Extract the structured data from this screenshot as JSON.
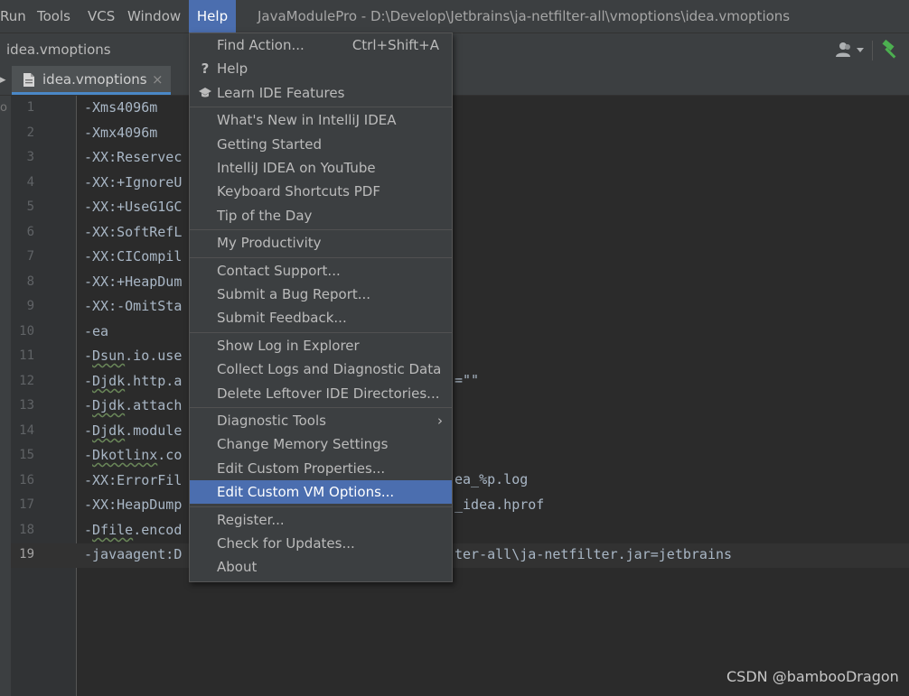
{
  "menubar": {
    "items": [
      "Run",
      "Tools",
      "VCS",
      "Window",
      "Help"
    ],
    "active": "Help",
    "window_title": "JavaModulePro - D:\\Develop\\Jetbrains\\ja-netfilter-all\\vmoptions\\idea.vmoptions"
  },
  "navbar": {
    "breadcrumb": "idea.vmoptions"
  },
  "tabs": [
    {
      "label": "idea.vmoptions",
      "close": "×"
    }
  ],
  "editor": {
    "current_line": "19",
    "lines": [
      {
        "no": "1",
        "pre": "-Xms4096m",
        "sq": "",
        "post": ""
      },
      {
        "no": "2",
        "pre": "-Xmx4096m",
        "sq": "",
        "post": ""
      },
      {
        "no": "3",
        "pre": "-XX:Reservec",
        "sq": "",
        "post": ""
      },
      {
        "no": "4",
        "pre": "-XX:+IgnoreU",
        "sq": "",
        "post": ""
      },
      {
        "no": "5",
        "pre": "-XX:+UseG1GC",
        "sq": "",
        "post": ""
      },
      {
        "no": "6",
        "pre": "-XX:SoftRefL",
        "sq": "",
        "post": ""
      },
      {
        "no": "7",
        "pre": "-XX:CICompil",
        "sq": "",
        "post": ""
      },
      {
        "no": "8",
        "pre": "-XX:+HeapDum",
        "sq": "",
        "post": ""
      },
      {
        "no": "9",
        "pre": "-XX:-OmitSta",
        "sq": "",
        "post": ""
      },
      {
        "no": "10",
        "pre": "-ea",
        "sq": "",
        "post": ""
      },
      {
        "no": "11",
        "pre": "-",
        "sq": "Dsun",
        "post": ".io.use"
      },
      {
        "no": "12",
        "pre": "-",
        "sq": "Djdk",
        "post": ".http.a"
      },
      {
        "no": "13",
        "pre": "-",
        "sq": "Djdk",
        "post": ".attach"
      },
      {
        "no": "14",
        "pre": "-",
        "sq": "Djdk",
        "post": ".module"
      },
      {
        "no": "15",
        "pre": "-",
        "sq": "Dkotlinx",
        "post": ".co"
      },
      {
        "no": "16",
        "pre": "-XX:ErrorFil",
        "sq": "",
        "post": ""
      },
      {
        "no": "17",
        "pre": "-XX:HeapDump",
        "sq": "",
        "post": ""
      },
      {
        "no": "18",
        "pre": "-",
        "sq": "Dfile",
        "post": ".encod"
      },
      {
        "no": "19",
        "pre": "-javaagent:D",
        "sq": "",
        "post": ""
      }
    ],
    "right_fragments": {
      "line12": "=\"\"",
      "line16": "ea_%p.log",
      "line17": "_idea.hprof",
      "line19": "ter-all\\ja-netfilter.jar=jetbrains"
    }
  },
  "help_menu": {
    "groups": [
      [
        {
          "label": "Find Action...",
          "shortcut": "Ctrl+Shift+A",
          "icon": ""
        },
        {
          "label": "Help",
          "shortcut": "",
          "icon": "?"
        },
        {
          "label": "Learn IDE Features",
          "shortcut": "",
          "icon": "graduation-cap"
        }
      ],
      [
        {
          "label": "What's New in IntelliJ IDEA",
          "shortcut": "",
          "icon": ""
        },
        {
          "label": "Getting Started",
          "shortcut": "",
          "icon": ""
        },
        {
          "label": "IntelliJ IDEA on YouTube",
          "shortcut": "",
          "icon": ""
        },
        {
          "label": "Keyboard Shortcuts PDF",
          "shortcut": "",
          "icon": ""
        },
        {
          "label": "Tip of the Day",
          "shortcut": "",
          "icon": ""
        }
      ],
      [
        {
          "label": "My Productivity",
          "shortcut": "",
          "icon": ""
        }
      ],
      [
        {
          "label": "Contact Support...",
          "shortcut": "",
          "icon": ""
        },
        {
          "label": "Submit a Bug Report...",
          "shortcut": "",
          "icon": ""
        },
        {
          "label": "Submit Feedback...",
          "shortcut": "",
          "icon": ""
        }
      ],
      [
        {
          "label": "Show Log in Explorer",
          "shortcut": "",
          "icon": ""
        },
        {
          "label": "Collect Logs and Diagnostic Data",
          "shortcut": "",
          "icon": ""
        },
        {
          "label": "Delete Leftover IDE Directories...",
          "shortcut": "",
          "icon": ""
        }
      ],
      [
        {
          "label": "Diagnostic Tools",
          "shortcut": "",
          "icon": "",
          "submenu": true
        },
        {
          "label": "Change Memory Settings",
          "shortcut": "",
          "icon": ""
        },
        {
          "label": "Edit Custom Properties...",
          "shortcut": "",
          "icon": ""
        },
        {
          "label": "Edit Custom VM Options...",
          "shortcut": "",
          "icon": "",
          "highlighted": true
        }
      ],
      [
        {
          "label": "Register...",
          "shortcut": "",
          "icon": ""
        },
        {
          "label": "Check for Updates...",
          "shortcut": "",
          "icon": ""
        },
        {
          "label": "About",
          "shortcut": "",
          "icon": ""
        }
      ]
    ]
  },
  "watermark": "CSDN @bambooDragon",
  "colors": {
    "highlight": "#4b6eaf",
    "background": "#2b2b2b",
    "chrome": "#3c3f41",
    "code_text": "#a9b7c6",
    "hammer_green": "#4caf50"
  }
}
